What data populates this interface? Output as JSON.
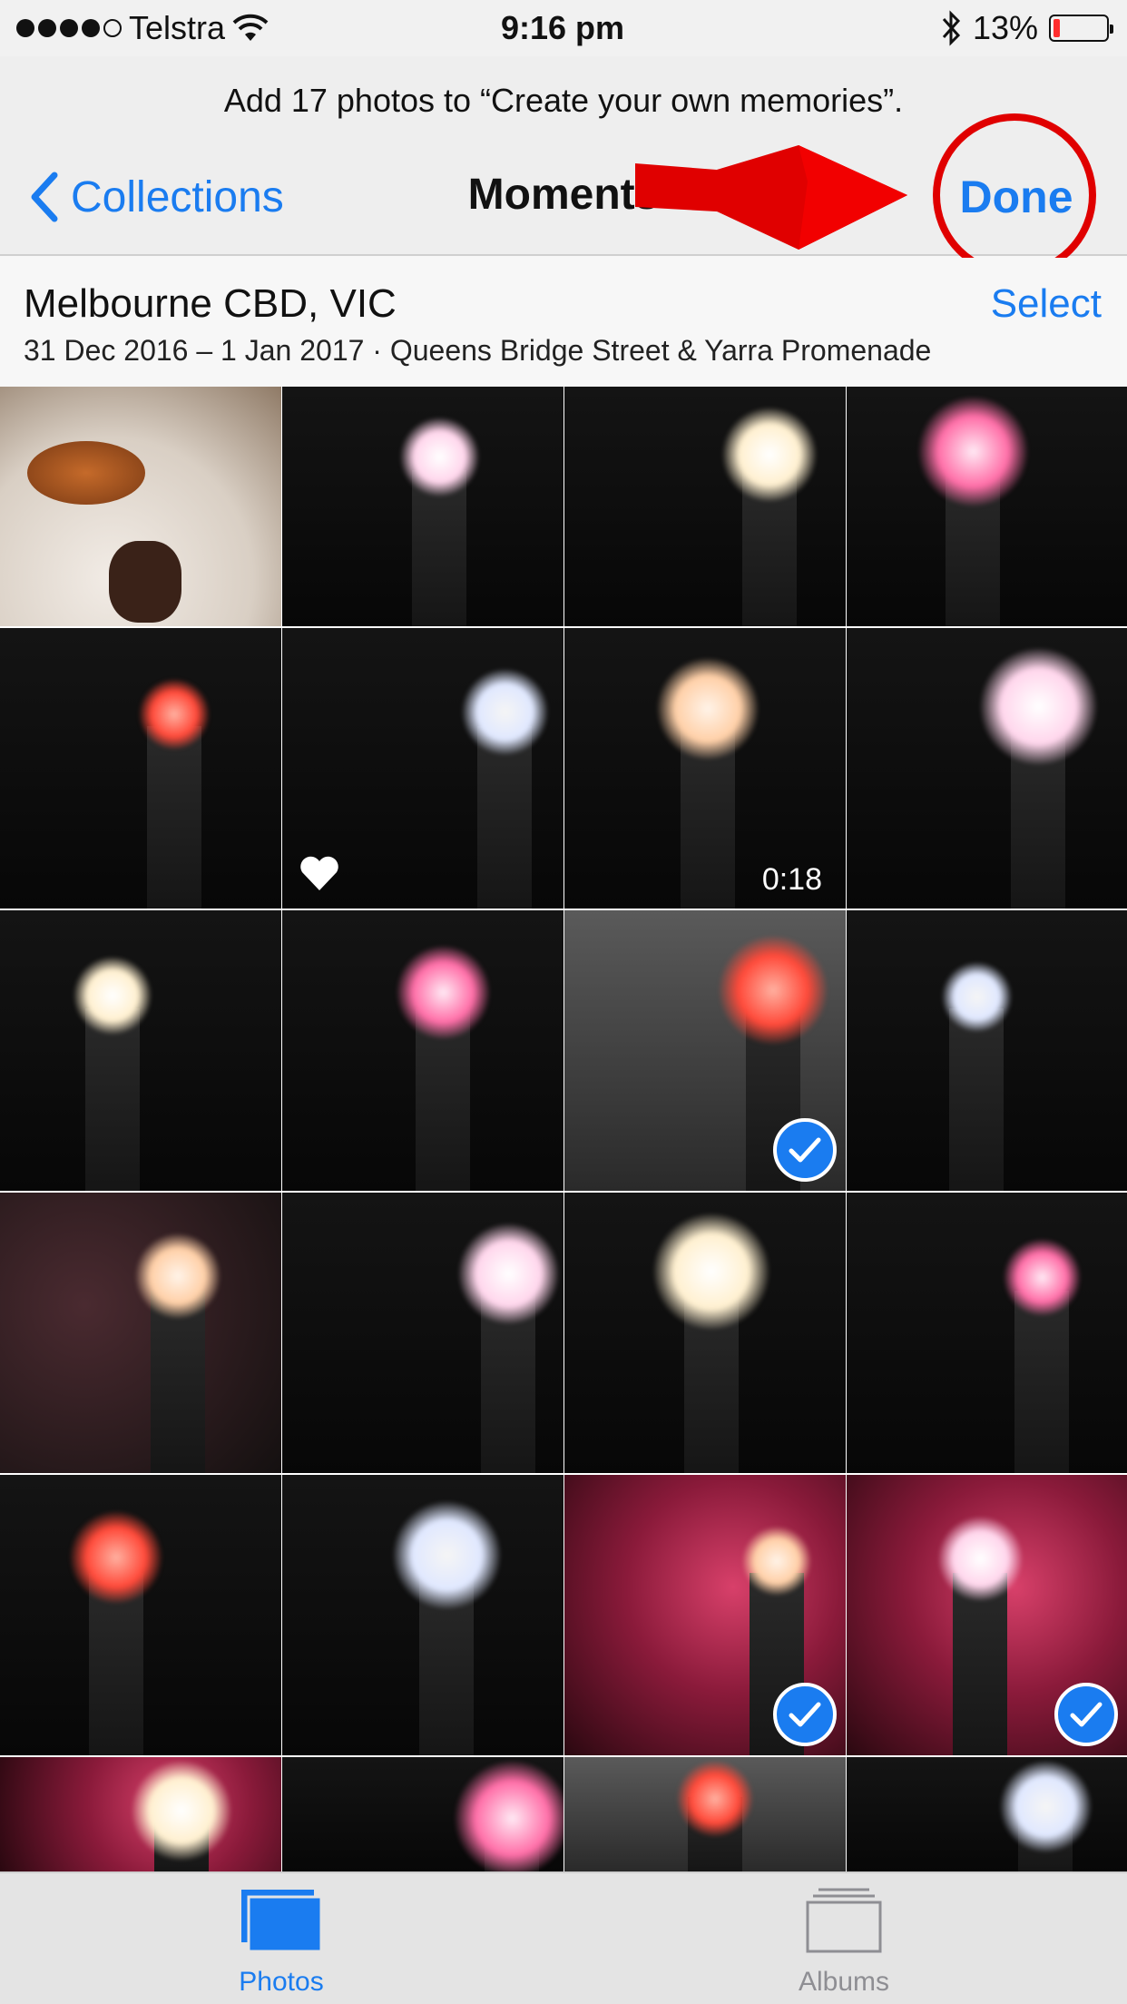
{
  "status_bar": {
    "carrier": "Telstra",
    "time": "9:16 pm",
    "battery_percent": "13%",
    "battery_level": 0.13,
    "signal_bars": 4,
    "signal_total": 5,
    "icons": [
      "wifi-icon",
      "bluetooth-icon",
      "battery-icon"
    ]
  },
  "prompt": "Add 17 photos to “Create your own memories”.",
  "nav": {
    "back_label": "Collections",
    "title": "Moments",
    "done_label": "Done"
  },
  "moment": {
    "title": "Melbourne CBD, VIC",
    "subtitle": "31 Dec 2016 – 1 Jan 2017 · Queens Bridge Street & Yarra Promenade",
    "select_label": "Select"
  },
  "photos": [
    {
      "kind": "food",
      "selected": false
    },
    {
      "kind": "fireworks",
      "selected": false
    },
    {
      "kind": "fireworks",
      "selected": false
    },
    {
      "kind": "fireworks",
      "selected": false
    },
    {
      "kind": "fireworks",
      "selected": false
    },
    {
      "kind": "fireworks",
      "selected": false,
      "favorite": true
    },
    {
      "kind": "video",
      "selected": false,
      "duration": "0:18"
    },
    {
      "kind": "fireworks",
      "selected": false
    },
    {
      "kind": "fireworks",
      "selected": false
    },
    {
      "kind": "fireworks",
      "selected": false
    },
    {
      "kind": "fireworks",
      "selected": true
    },
    {
      "kind": "fireworks",
      "selected": false
    },
    {
      "kind": "fireworks",
      "selected": false
    },
    {
      "kind": "fireworks",
      "selected": false
    },
    {
      "kind": "fireworks",
      "selected": false
    },
    {
      "kind": "fireworks",
      "selected": false
    },
    {
      "kind": "fireworks",
      "selected": false
    },
    {
      "kind": "fireworks",
      "selected": false
    },
    {
      "kind": "fireworks",
      "selected": true
    },
    {
      "kind": "fireworks",
      "selected": true
    },
    {
      "kind": "fireworks",
      "selected": false
    },
    {
      "kind": "fireworks",
      "selected": false
    },
    {
      "kind": "fireworks",
      "selected": false
    },
    {
      "kind": "fireworks",
      "selected": false
    }
  ],
  "tab_bar": {
    "tabs": [
      {
        "label": "Photos",
        "active": true
      },
      {
        "label": "Albums",
        "active": false
      }
    ]
  },
  "colors": {
    "accent": "#1a7cf0",
    "annotation_red": "#e00000"
  }
}
